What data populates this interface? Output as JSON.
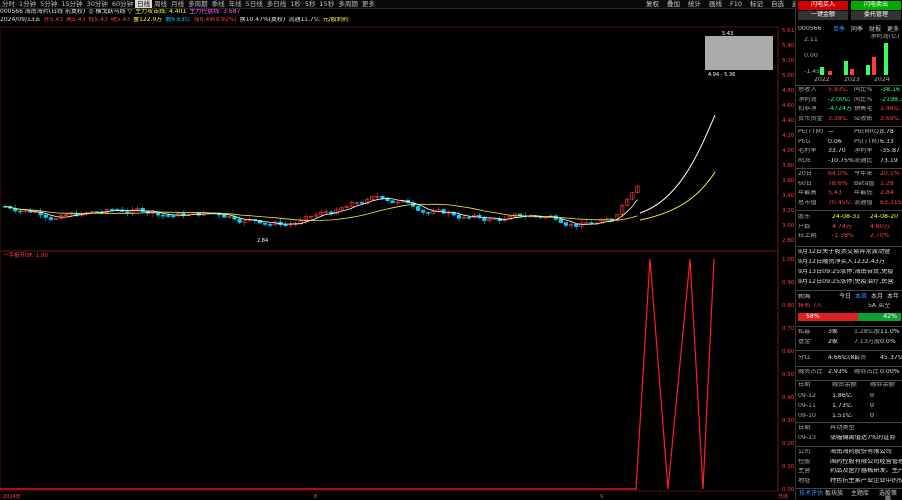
{
  "period_tabs": [
    "分时",
    "1分钟",
    "5分钟",
    "15分钟",
    "30分钟",
    "60分钟",
    "日线",
    "周线",
    "月线",
    "多周期",
    "季线",
    "年线",
    "5日线",
    "多日线",
    "1秒",
    "5秒",
    "15秒",
    "多周期",
    "更多"
  ],
  "period_active": "日线",
  "toolbar": [
    "复权",
    "叠加",
    "统计",
    "画线",
    "F10",
    "标记",
    "自选",
    "返回"
  ],
  "info1": [
    {
      "t": "000566 海南海药(日线 前复权)",
      "c": "#e0e0e0"
    },
    {
      "t": "◎ 横戈跃马线 ▽",
      "c": "#e0e0e0"
    },
    {
      "t": "主力攻击线: 4.401",
      "c": "#ffff33"
    },
    {
      "t": "主力控盘线: 3.687",
      "c": "#ff66ff"
    }
  ],
  "info2": [
    {
      "t": "2024/09/13五",
      "c": "#e0e0e0"
    },
    {
      "t": "开5.43",
      "c": "#ff4040"
    },
    {
      "t": "高5.43",
      "c": "#ff4040"
    },
    {
      "t": "低5.43",
      "c": "#ff4040"
    },
    {
      "t": "收5.43",
      "c": "#ff4040"
    },
    {
      "t": "量122.0万",
      "c": "#ffff33"
    },
    {
      "t": "额6.63亿",
      "c": "#00ccff"
    },
    {
      "t": "涨0.49(9.92%)",
      "c": "#ff4040"
    },
    {
      "t": "换10.47%(复权)",
      "c": "#e0e0e0"
    },
    {
      "t": "流通11.7亿",
      "c": "#e0e0e0"
    },
    {
      "t": "元/股制药",
      "c": "#ffff33"
    }
  ],
  "price_axis": [
    "5.61",
    "5.40",
    "5.20",
    "5.00",
    "4.80",
    "4.60",
    "4.40",
    "4.20",
    "4.00",
    "3.80",
    "3.60",
    "3.40",
    "3.20",
    "3.00",
    "2.80"
  ],
  "indicator_axis": [
    "1.00",
    "0.90",
    "0.80",
    "0.70",
    "0.60",
    "0.50",
    "0.40",
    "0.30",
    "0.20",
    "0.10",
    "0.00"
  ],
  "indicator_title": "一字板开DF: 1.00",
  "popup": {
    "top": "5.43",
    "bottom": "4.94 - 5.36"
  },
  "low_label": "2.84",
  "high_label": "5.43",
  "bottom_labels": {
    "left": "2024年",
    "m1": "8",
    "m2": "9",
    "right": "日线"
  },
  "right": {
    "buttons": [
      "闪电买入",
      "闪电卖出",
      "一键金额",
      "委托管理"
    ],
    "code": "000566",
    "tabs": [
      "单季",
      "同季",
      "财报",
      "更多"
    ],
    "mini_title": "净利润(亿)",
    "mini_y": [
      "2.11",
      "0.00",
      "-1.45"
    ],
    "mini_x": [
      "2022",
      "2023",
      "2024"
    ],
    "fin": [
      [
        "总收入",
        "5.93亿",
        "同比%",
        "-38.16"
      ],
      [
        "净利润",
        "-2.00亿",
        "同比%",
        "-2198.34"
      ],
      [
        "扣非净",
        "-4724万",
        "销售毛",
        "1.46亿"
      ],
      [
        "货币资金",
        "3.38亿",
        "应收账",
        "3.69亿"
      ]
    ],
    "val": [
      [
        "PE(TTM)",
        "—",
        "PB(MRQ)",
        "3.78"
      ],
      [
        "PEG",
        "0.06",
        "PS(TTM)",
        "6.33"
      ],
      [
        "毛利率",
        "33.70",
        "净利率",
        "-35.87"
      ],
      [
        "ROE",
        "-10.75%",
        "流通比",
        "73.19"
      ]
    ],
    "hl": [
      [
        "20日",
        "64.0%",
        "今年来",
        "20.1%"
      ],
      [
        "60日",
        "78.6%",
        "Beta值",
        "1.28"
      ],
      [
        "年最高",
        "5.43",
        "年最低",
        "2.84"
      ],
      [
        "总市值",
        "70.45亿",
        "流通值",
        "63.31亿"
      ]
    ],
    "holders": [
      [
        "股东",
        "24-08-31",
        "24-08-20"
      ],
      [
        "户数",
        "4.74万",
        "4.80万"
      ],
      [
        "较上期",
        "-1.38%",
        "2.70%"
      ]
    ],
    "news": [
      "9月12日关于股票交易异常波动暨",
      "9月12日融资净买入1232.43万",
      "9月13日09:25涨停:海南自贸,免疫",
      "9月12日09:25涨停:免疫治疗,民营"
    ],
    "flow_tabs": [
      "今日",
      "本周",
      "本月",
      "本年"
    ],
    "flow_labels": [
      "新闻",
      "5A",
      "买空"
    ],
    "flow_rank": [
      "排名 7人",
      "5A 买空"
    ],
    "flow_bar": {
      "left": "58%",
      "right": "42%",
      "ratio": 0.58
    },
    "inst": [
      [
        "私募",
        "3家",
        "1.28亿股",
        "11.0%"
      ],
      [
        "基金",
        "2家",
        "7.13万股",
        "0.0%"
      ]
    ],
    "div": [
      [
        "分红",
        "4.66亿(8)",
        "募资",
        "45.37亿(2)"
      ]
    ],
    "margin_ratio": [
      [
        "融资占比",
        "2.93%",
        "融券占比",
        "0.00%"
      ]
    ],
    "margin_head": [
      "日期",
      "融资余额",
      "融券余额"
    ],
    "margin": [
      [
        "09-12",
        "1.86亿",
        "0"
      ],
      [
        "09-11",
        "1.73亿",
        "0"
      ],
      [
        "09-10",
        "1.51亿",
        "0"
      ]
    ],
    "abn_head": [
      "日期",
      "异动类型"
    ],
    "abn": [
      [
        "09-13",
        "涨幅偏离值达7%的证券"
      ]
    ],
    "company": [
      [
        "公司",
        "海南海药股份有限公司"
      ],
      [
        "控股",
        "国药控股有限公司经营管理委"
      ],
      [
        "主营",
        "药品及医疗器械研发、生产"
      ],
      [
        "地址",
        "特色抗生素产业企业中的佼"
      ]
    ],
    "footer": [
      "技术评估",
      "板块族",
      "主题库",
      "选股策略"
    ]
  },
  "colors": {
    "up": "#ff3b3b",
    "down": "#00d0ff",
    "ma1": "#ffffff",
    "ma2": "#ffee33",
    "ind": "#ff2020"
  }
}
